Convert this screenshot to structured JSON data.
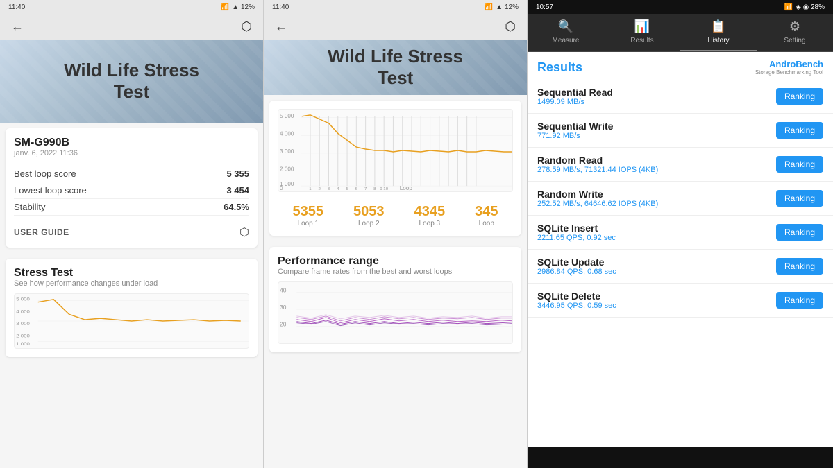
{
  "panel_left": {
    "status_time": "11:40",
    "status_icons": "⊙ ⊙ ◎ •",
    "status_right": "▲ 12%",
    "hero_title": "Wild Life Stress\nTest",
    "device_name": "SM-G990B",
    "device_date": "janv. 6, 2022 11:36",
    "scores": [
      {
        "label": "Best loop score",
        "value": "5 355"
      },
      {
        "label": "Lowest loop score",
        "value": "3 454"
      },
      {
        "label": "Stability",
        "value": "64.5%"
      }
    ],
    "user_guide": "USER GUIDE",
    "section_title": "Stress Test",
    "section_subtitle": "See how performance changes under load",
    "chart_y_labels": [
      "5 000",
      "4 000",
      "3 000",
      "2 000",
      "1 000"
    ]
  },
  "panel_mid": {
    "status_time": "11:40",
    "status_icons": "⊙ ⊙ ◎ •",
    "status_right": "▲ 12%",
    "hero_title": "Wild Life Stress\nTest",
    "loop_scores": [
      {
        "value": "5355",
        "label": "Loop 1"
      },
      {
        "value": "5053",
        "label": "Loop 2"
      },
      {
        "value": "4345",
        "label": "Loop 3"
      },
      {
        "value": "345",
        "label": "Loop"
      }
    ],
    "perf_range_title": "Performance range",
    "perf_range_sub": "Compare frame rates from the best and worst loops",
    "chart_y_labels": [
      "40",
      "30",
      "20"
    ],
    "chart_x_labels": []
  },
  "panel_right": {
    "status_time": "10:57",
    "status_icons": "▣ ▣ ▣ •",
    "status_right": "◈ ◉ 28%",
    "nav_tabs": [
      {
        "icon": "🔍",
        "label": "Measure",
        "active": false
      },
      {
        "icon": "📊",
        "label": "Results",
        "active": false
      },
      {
        "icon": "📋",
        "label": "History",
        "active": true
      },
      {
        "icon": "⚙",
        "label": "Setting",
        "active": false
      }
    ],
    "results_title": "Results",
    "androbench_name": "AndroBench",
    "androbench_sub": "Storage Benchmarking Tool",
    "benchmarks": [
      {
        "name": "Sequential Read",
        "value": "1499.09 MB/s",
        "btn": "Ranking"
      },
      {
        "name": "Sequential Write",
        "value": "771.92 MB/s",
        "btn": "Ranking"
      },
      {
        "name": "Random Read",
        "value": "278.59 MB/s, 71321.44 IOPS (4KB)",
        "btn": "Ranking"
      },
      {
        "name": "Random Write",
        "value": "252.52 MB/s, 64646.62 IOPS (4KB)",
        "btn": "Ranking"
      },
      {
        "name": "SQLite Insert",
        "value": "2211.65 QPS, 0.92 sec",
        "btn": "Ranking"
      },
      {
        "name": "SQLite Update",
        "value": "2986.84 QPS, 0.68 sec",
        "btn": "Ranking"
      },
      {
        "name": "SQLite Delete",
        "value": "3446.95 QPS, 0.59 sec",
        "btn": "Ranking"
      }
    ]
  },
  "colors": {
    "accent_blue": "#2196f3",
    "accent_orange": "#e8a020",
    "accent_purple": "#9c27b0"
  }
}
